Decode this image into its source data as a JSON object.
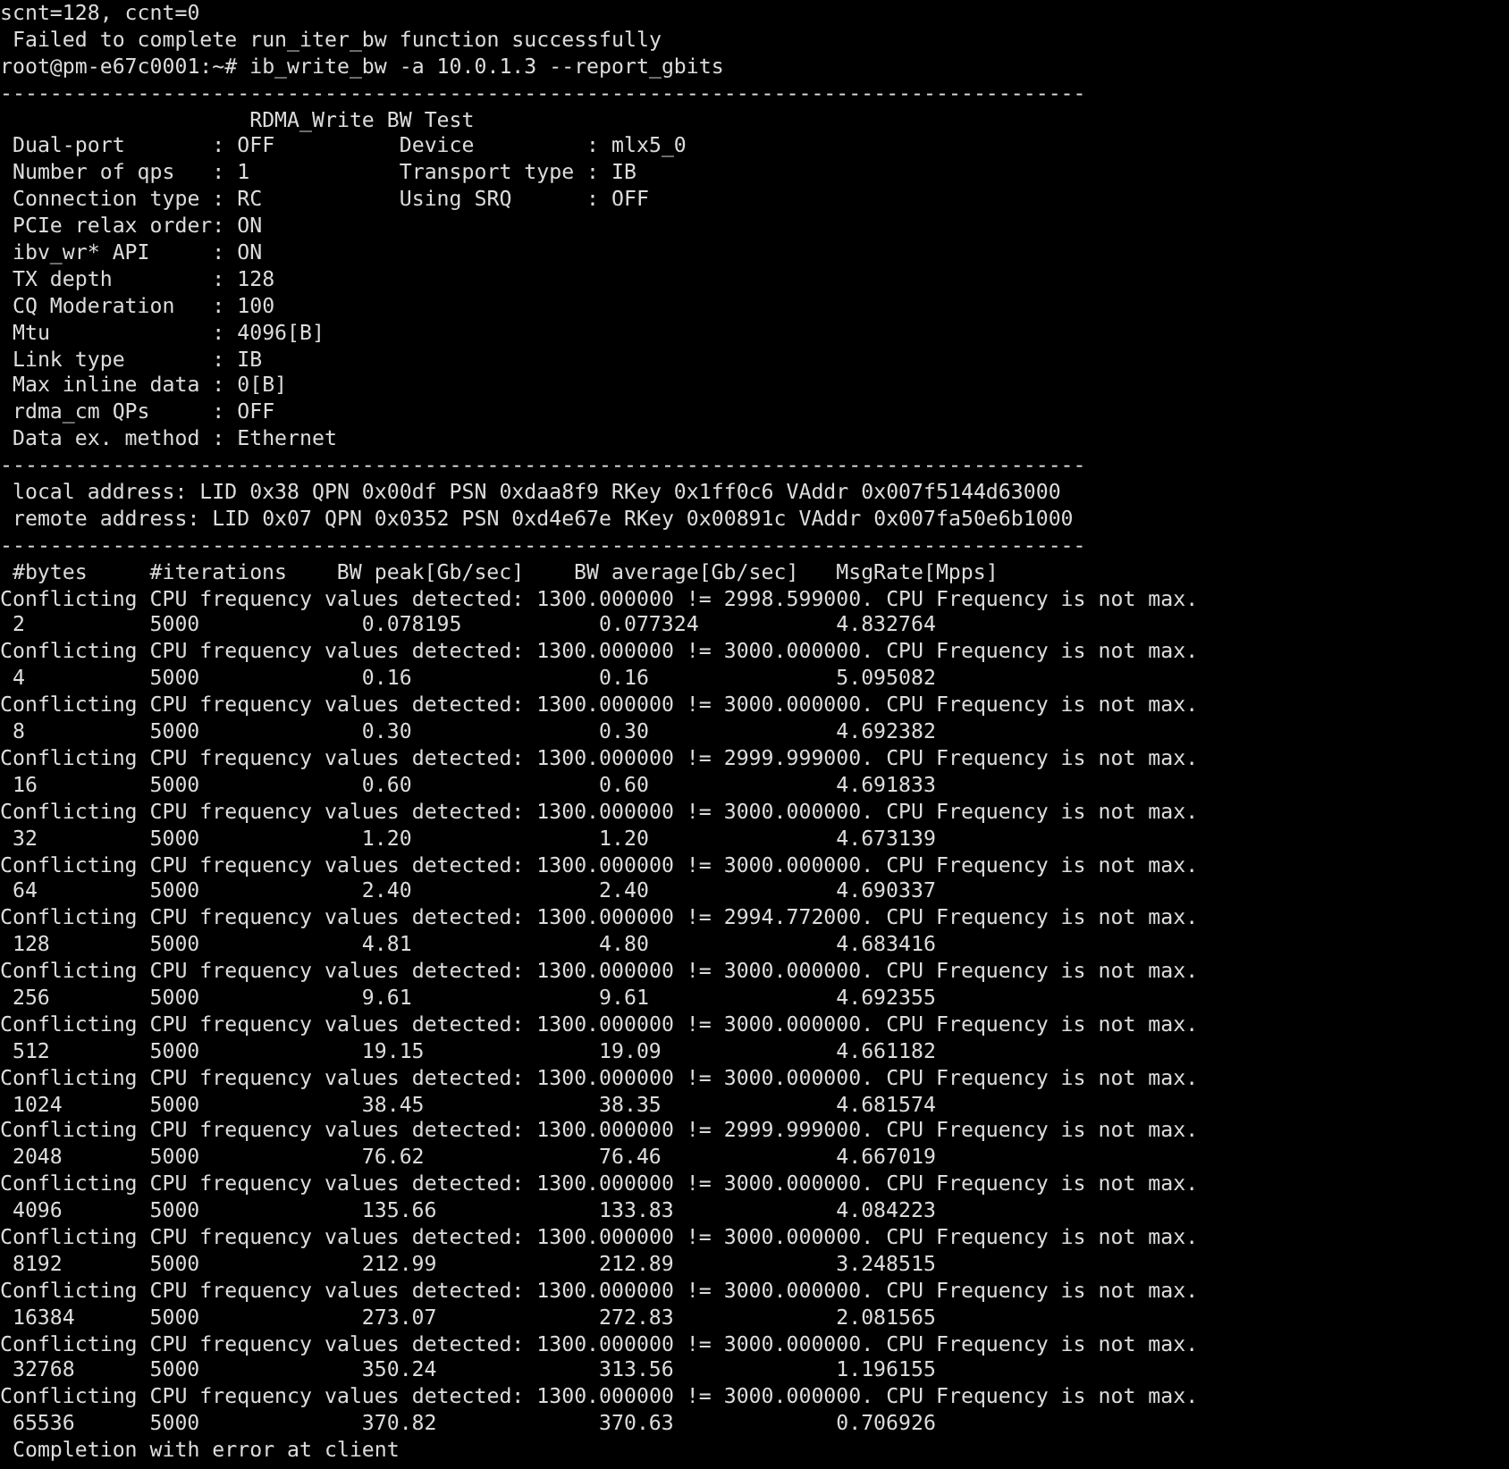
{
  "terminal": {
    "lines": [
      "scnt=128, ccnt=0",
      " Failed to complete run_iter_bw function successfully",
      "root@pm-e67c0001:~# ib_write_bw -a 10.0.1.3 --report_gbits",
      "---------------------------------------------------------------------------------------",
      "                    RDMA_Write BW Test",
      " Dual-port       : OFF          Device         : mlx5_0",
      " Number of qps   : 1            Transport type : IB",
      " Connection type : RC           Using SRQ      : OFF",
      " PCIe relax order: ON",
      " ibv_wr* API     : ON",
      " TX depth        : 128",
      " CQ Moderation   : 100",
      " Mtu             : 4096[B]",
      " Link type       : IB",
      " Max inline data : 0[B]",
      " rdma_cm QPs     : OFF",
      " Data ex. method : Ethernet",
      "---------------------------------------------------------------------------------------",
      " local address: LID 0x38 QPN 0x00df PSN 0xdaa8f9 RKey 0x1ff0c6 VAddr 0x007f5144d63000",
      " remote address: LID 0x07 QPN 0x0352 PSN 0xd4e67e RKey 0x00891c VAddr 0x007fa50e6b1000",
      "---------------------------------------------------------------------------------------"
    ],
    "columns": [
      "#bytes",
      "#iterations",
      "BW peak[Gb/sec]",
      "BW average[Gb/sec]",
      "MsgRate[Mpps]"
    ],
    "results": [
      {
        "warning": "Conflicting CPU frequency values detected: 1300.000000 != 2998.599000. CPU Frequency is not max.",
        "values": [
          "2",
          "5000",
          "0.078195",
          "0.077324",
          "4.832764"
        ]
      },
      {
        "warning": "Conflicting CPU frequency values detected: 1300.000000 != 3000.000000. CPU Frequency is not max.",
        "values": [
          "4",
          "5000",
          "0.16",
          "0.16",
          "5.095082"
        ]
      },
      {
        "warning": "Conflicting CPU frequency values detected: 1300.000000 != 3000.000000. CPU Frequency is not max.",
        "values": [
          "8",
          "5000",
          "0.30",
          "0.30",
          "4.692382"
        ]
      },
      {
        "warning": "Conflicting CPU frequency values detected: 1300.000000 != 2999.999000. CPU Frequency is not max.",
        "values": [
          "16",
          "5000",
          "0.60",
          "0.60",
          "4.691833"
        ]
      },
      {
        "warning": "Conflicting CPU frequency values detected: 1300.000000 != 3000.000000. CPU Frequency is not max.",
        "values": [
          "32",
          "5000",
          "1.20",
          "1.20",
          "4.673139"
        ]
      },
      {
        "warning": "Conflicting CPU frequency values detected: 1300.000000 != 3000.000000. CPU Frequency is not max.",
        "values": [
          "64",
          "5000",
          "2.40",
          "2.40",
          "4.690337"
        ]
      },
      {
        "warning": "Conflicting CPU frequency values detected: 1300.000000 != 2994.772000. CPU Frequency is not max.",
        "values": [
          "128",
          "5000",
          "4.81",
          "4.80",
          "4.683416"
        ]
      },
      {
        "warning": "Conflicting CPU frequency values detected: 1300.000000 != 3000.000000. CPU Frequency is not max.",
        "values": [
          "256",
          "5000",
          "9.61",
          "9.61",
          "4.692355"
        ]
      },
      {
        "warning": "Conflicting CPU frequency values detected: 1300.000000 != 3000.000000. CPU Frequency is not max.",
        "values": [
          "512",
          "5000",
          "19.15",
          "19.09",
          "4.661182"
        ]
      },
      {
        "warning": "Conflicting CPU frequency values detected: 1300.000000 != 3000.000000. CPU Frequency is not max.",
        "values": [
          "1024",
          "5000",
          "38.45",
          "38.35",
          "4.681574"
        ]
      },
      {
        "warning": "Conflicting CPU frequency values detected: 1300.000000 != 2999.999000. CPU Frequency is not max.",
        "values": [
          "2048",
          "5000",
          "76.62",
          "76.46",
          "4.667019"
        ]
      },
      {
        "warning": "Conflicting CPU frequency values detected: 1300.000000 != 3000.000000. CPU Frequency is not max.",
        "values": [
          "4096",
          "5000",
          "135.66",
          "133.83",
          "4.084223"
        ]
      },
      {
        "warning": "Conflicting CPU frequency values detected: 1300.000000 != 3000.000000. CPU Frequency is not max.",
        "values": [
          "8192",
          "5000",
          "212.99",
          "212.89",
          "3.248515"
        ]
      },
      {
        "warning": "Conflicting CPU frequency values detected: 1300.000000 != 3000.000000. CPU Frequency is not max.",
        "values": [
          "16384",
          "5000",
          "273.07",
          "272.83",
          "2.081565"
        ]
      },
      {
        "warning": "Conflicting CPU frequency values detected: 1300.000000 != 3000.000000. CPU Frequency is not max.",
        "values": [
          "32768",
          "5000",
          "350.24",
          "313.56",
          "1.196155"
        ]
      },
      {
        "warning": "Conflicting CPU frequency values detected: 1300.000000 != 3000.000000. CPU Frequency is not max.",
        "values": [
          "65536",
          "5000",
          "370.82",
          "370.63",
          "0.706926"
        ]
      }
    ],
    "footer": " Completion with error at client"
  }
}
